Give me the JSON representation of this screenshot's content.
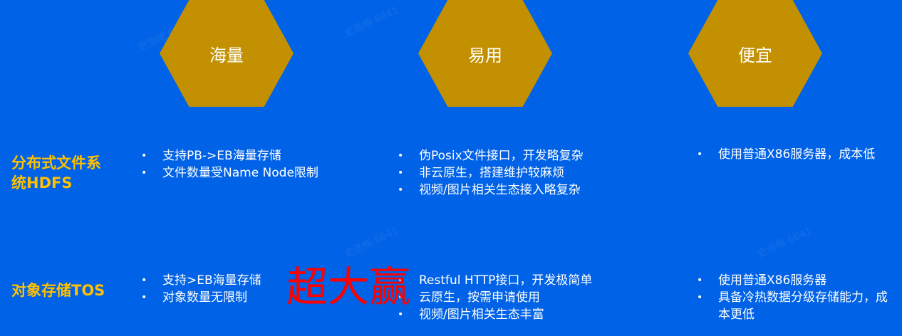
{
  "watermark": "史浩楠 6641",
  "columns": [
    "海量",
    "易用",
    "便宜"
  ],
  "rows": [
    {
      "label": "分布式文件系统HDFS",
      "cells": [
        [
          "支持PB->EB海量存储",
          "文件数量受Name Node限制"
        ],
        [
          "伪Posix文件接口，开发略复杂",
          "非云原生，搭建维护较麻烦",
          "视频/图片相关生态接入略复杂"
        ],
        [
          "使用普通X86服务器，成本低"
        ]
      ]
    },
    {
      "label": "对象存储TOS",
      "cells": [
        [
          "支持>EB海量存储",
          "对象数量无限制"
        ],
        [
          "Restful HTTP接口，开发极简单",
          "云原生，按需申请使用",
          "视频/图片相关生态丰富"
        ],
        [
          "使用普通X86服务器",
          "具备冷热数据分级存储能力，成本更低"
        ]
      ]
    }
  ],
  "highlight": "超大赢",
  "colors": {
    "background": "#0062E6",
    "hexagon": "#C29000",
    "row_label": "#FFC000",
    "highlight": "#FF0000"
  }
}
